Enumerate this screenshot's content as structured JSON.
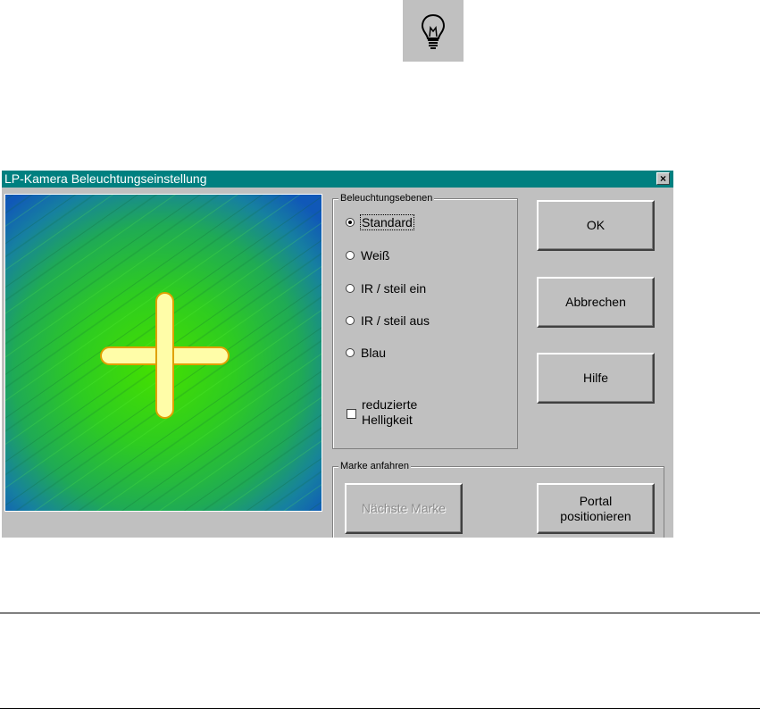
{
  "dialog": {
    "title": "LP-Kamera Beleuchtungseinstellung",
    "close_glyph": "×"
  },
  "lighting": {
    "group_label": "Beleuchtungsebenen",
    "options": [
      {
        "label": "Standard",
        "checked": true
      },
      {
        "label": "Weiß",
        "checked": false
      },
      {
        "label": "IR / steil ein",
        "checked": false
      },
      {
        "label": "IR / steil aus",
        "checked": false
      },
      {
        "label": "Blau",
        "checked": false
      }
    ],
    "reduced_brightness": {
      "label_line1": "reduzierte",
      "label_line2": "Helligkeit",
      "checked": false
    }
  },
  "buttons": {
    "ok": "OK",
    "cancel": "Abbrechen",
    "help": "Hilfe"
  },
  "mark": {
    "group_label": "Marke anfahren",
    "next_mark": "Nächste Marke",
    "portal_line1": "Portal",
    "portal_line2": "positionieren"
  },
  "colors": {
    "titlebar": "#008080",
    "dialog_bg": "#c0c0c0",
    "crosshair_fill": "#fffda8",
    "crosshair_border": "#e0a000"
  },
  "icons": {
    "toolbar": "lightbulb-icon",
    "close": "close-icon"
  }
}
